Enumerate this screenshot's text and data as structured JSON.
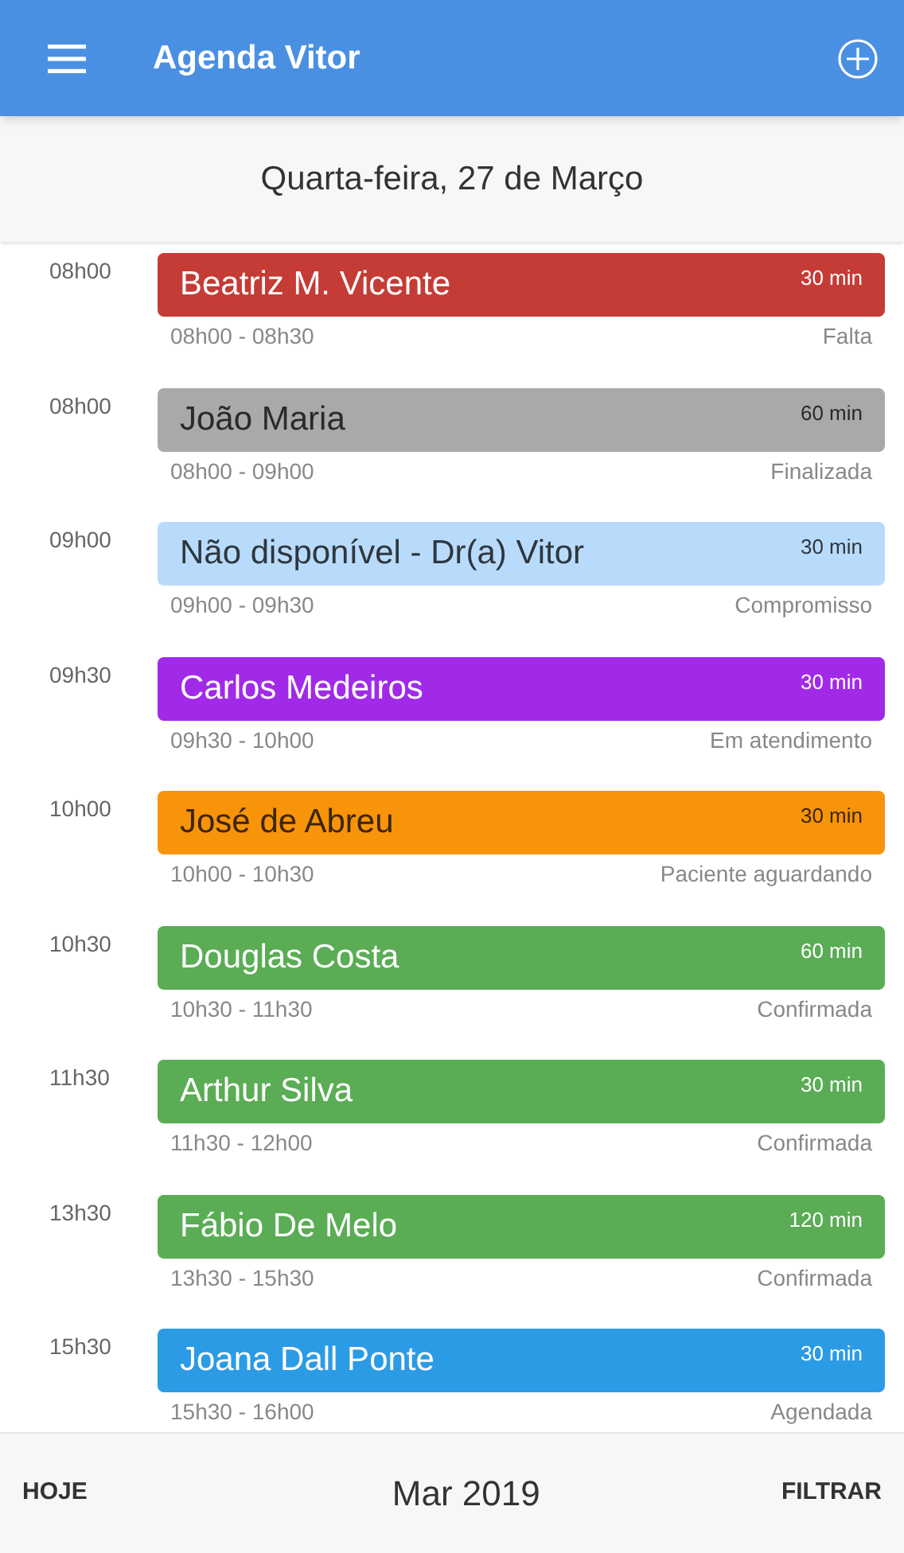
{
  "app_bar": {
    "title": "Agenda Vitor"
  },
  "date_header": "Quarta-feira, 27 de Março",
  "appointments": [
    {
      "time": "08h00",
      "name": "Beatriz M. Vicente",
      "duration": "30 min",
      "range": "08h00 - 08h30",
      "status": "Falta",
      "color": "#c53b35"
    },
    {
      "time": "08h00",
      "name": "João Maria",
      "duration": "60 min",
      "range": "08h00 - 09h00",
      "status": "Finalizada",
      "color": "#a9a9a9"
    },
    {
      "time": "09h00",
      "name": "Não disponível - Dr(a) Vitor",
      "duration": "30 min",
      "range": "09h00 - 09h30",
      "status": "Compromisso",
      "color": "#b9dbfb"
    },
    {
      "time": "09h30",
      "name": "Carlos Medeiros",
      "duration": "30 min",
      "range": "09h30 - 10h00",
      "status": "Em atendimento",
      "color": "#a12ae8"
    },
    {
      "time": "10h00",
      "name": "José de Abreu",
      "duration": "30 min",
      "range": "10h00 - 10h30",
      "status": "Paciente aguardando",
      "color": "#f7940a"
    },
    {
      "time": "10h30",
      "name": "Douglas Costa",
      "duration": "60 min",
      "range": "10h30 - 11h30",
      "status": "Confirmada",
      "color": "#5aac55"
    },
    {
      "time": "11h30",
      "name": "Arthur Silva",
      "duration": "30 min",
      "range": "11h30 - 12h00",
      "status": "Confirmada",
      "color": "#5aac55"
    },
    {
      "time": "13h30",
      "name": "Fábio De Melo",
      "duration": "120 min",
      "range": "13h30 - 15h30",
      "status": "Confirmada",
      "color": "#5aac55"
    },
    {
      "time": "15h30",
      "name": "Joana Dall Ponte",
      "duration": "30 min",
      "range": "15h30 - 16h00",
      "status": "Agendada",
      "color": "#2b9be6"
    }
  ],
  "footer": {
    "today": "HOJE",
    "month": "Mar 2019",
    "filter": "FILTRAR"
  }
}
